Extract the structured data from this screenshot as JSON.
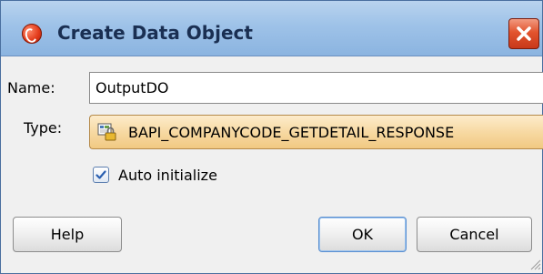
{
  "window": {
    "title": "Create Data Object"
  },
  "form": {
    "name_label": "Name:",
    "name_value": "OutputDO",
    "type_label": "Type:",
    "type_value": "BAPI_COMPANYCODE_GETDETAIL_RESPONSE",
    "auto_initialize_label": "Auto initialize",
    "auto_initialize_checked": true
  },
  "buttons": {
    "help": "Help",
    "ok": "OK",
    "cancel": "Cancel"
  },
  "icons": {
    "app_logo": "oracle-logo-icon",
    "close": "close-icon",
    "type": "data-type-lock-icon",
    "checkbox": "checkmark-icon",
    "resize": "resize-grip-icon"
  },
  "colors": {
    "titlebar": "#9ec2e8",
    "close_button": "#e2542e",
    "type_field": "#f7d9a3"
  }
}
